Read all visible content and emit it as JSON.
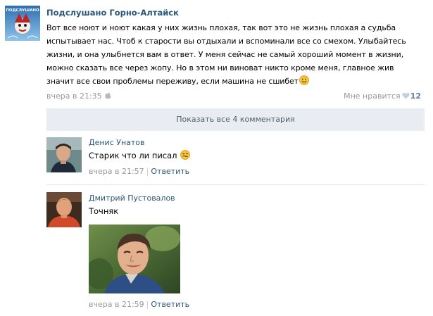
{
  "post": {
    "group_name": "Подслушано Горно-Алтайск",
    "avatar_text": "ПОДСЛУШАНО",
    "text": "Вот все ноют и ноют какая у них жизнь плохая, так вот это не жизнь плохая а судьба испытывает нас. Чтоб к старости вы отдыхали и вспоминали все со смехом. Улыбайтесь жизни, и она улыбнется вам в ответ. У меня сейчас не самый хороший момент в жизни, можно сказать все через жопу. Но в этом ни виноват никто кроме меня, главное жив значит все свои проблемы переживу, если машина не сшибет",
    "date": "вчера в 21:35",
    "like_label": "Мне нравится",
    "like_count": "12",
    "show_all_comments": "Показать все 4 комментария"
  },
  "comments": [
    {
      "author": "Денис Унатов",
      "text": "Старик что ли писал",
      "date": "вчера в 21:57",
      "sep": "|",
      "reply": "Ответить"
    },
    {
      "author": "Дмитрий Пустовалов",
      "text": "Точняк",
      "date": "вчера в 21:59",
      "sep": "|",
      "reply": "Ответить"
    }
  ],
  "colors": {
    "link": "#2b587a",
    "muted": "#999999",
    "bar_bg": "#e9edf1"
  }
}
